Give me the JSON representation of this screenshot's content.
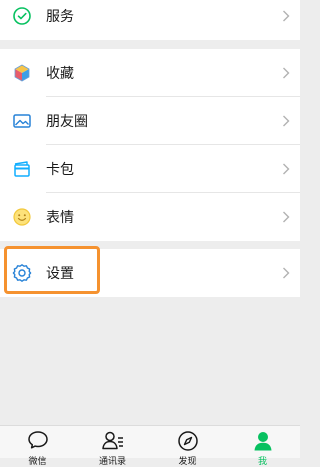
{
  "menu": {
    "service": {
      "label": "服务",
      "icon": "service-check-icon",
      "color": "#07c160"
    },
    "favorites": {
      "label": "收藏",
      "icon": "favorites-cube-icon"
    },
    "moments": {
      "label": "朋友圈",
      "icon": "moments-photo-icon",
      "color": "#2782d7"
    },
    "cards": {
      "label": "卡包",
      "icon": "card-wallet-icon",
      "color": "#10aeff"
    },
    "stickers": {
      "label": "表情",
      "icon": "sticker-smile-icon",
      "color": "#f2c83b"
    },
    "settings": {
      "label": "设置",
      "icon": "settings-gear-icon",
      "color": "#2782d7"
    }
  },
  "highlight_color": "#f5922f",
  "tabbar": {
    "tabs": [
      {
        "label": "微信",
        "icon": "chat-bubble-icon",
        "active": false
      },
      {
        "label": "通讯录",
        "icon": "contacts-icon",
        "active": false
      },
      {
        "label": "发现",
        "icon": "discover-compass-icon",
        "active": false
      },
      {
        "label": "我",
        "icon": "me-person-icon",
        "active": true
      }
    ],
    "active_color": "#07c160"
  }
}
